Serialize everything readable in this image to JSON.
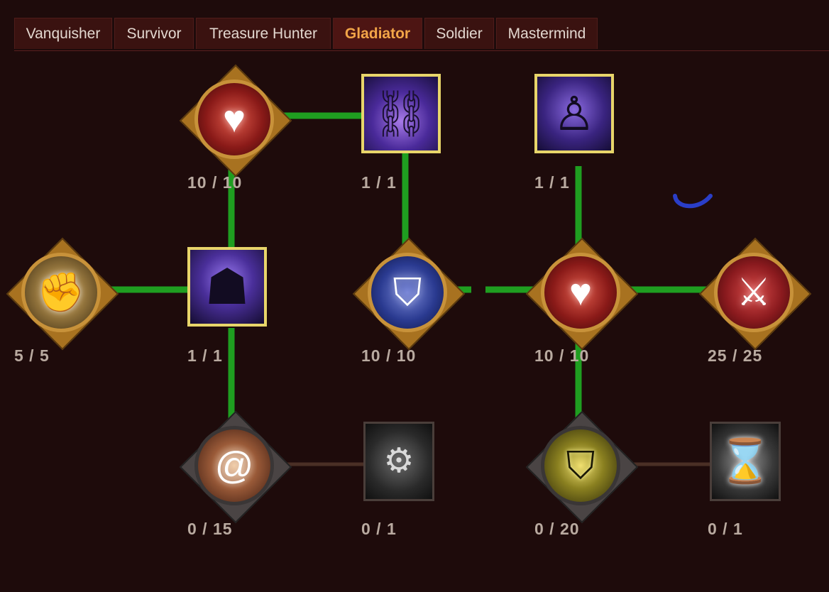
{
  "tabs": [
    {
      "label": "Vanquisher",
      "active": false
    },
    {
      "label": "Survivor",
      "active": false
    },
    {
      "label": "Treasure Hunter",
      "active": false
    },
    {
      "label": "Gladiator",
      "active": true
    },
    {
      "label": "Soldier",
      "active": false
    },
    {
      "label": "Mastermind",
      "active": false
    }
  ],
  "colors": {
    "active_link": "#1f9e20",
    "inactive_link": "#4a2f25",
    "active_tab_text": "#f2a548",
    "background": "#1e0b0b"
  },
  "nodes": {
    "heart_top": {
      "icon": "heart-gem-icon",
      "rank": "10 / 10",
      "active": true
    },
    "shackled_boot": {
      "icon": "shackled-boot-icon",
      "rank": "1 / 1",
      "active": true
    },
    "spear_warrior": {
      "icon": "spear-warrior-icon",
      "rank": "1 / 1",
      "active": true
    },
    "fist": {
      "icon": "fist-icon",
      "rank": "5 / 5",
      "active": true
    },
    "shadow_figure": {
      "icon": "shadow-figure-icon",
      "rank": "1 / 1",
      "active": true
    },
    "blue_shield": {
      "icon": "blue-shield-icon",
      "rank": "10 / 10",
      "active": true
    },
    "heart_mid": {
      "icon": "heart-gem-icon",
      "rank": "10 / 10",
      "active": true
    },
    "crossed_swords": {
      "icon": "crossed-swords-icon",
      "rank": "25 / 25",
      "active": true
    },
    "swirl": {
      "icon": "swirl-icon",
      "rank": "0 / 15",
      "active": false
    },
    "bear_trap": {
      "icon": "bear-trap-icon",
      "rank": "0 / 1",
      "active": false
    },
    "gold_shield": {
      "icon": "gold-shield-icon",
      "rank": "0 / 20",
      "active": false
    },
    "hourglass": {
      "icon": "hourglass-icon",
      "rank": "0 / 1",
      "active": false
    }
  }
}
